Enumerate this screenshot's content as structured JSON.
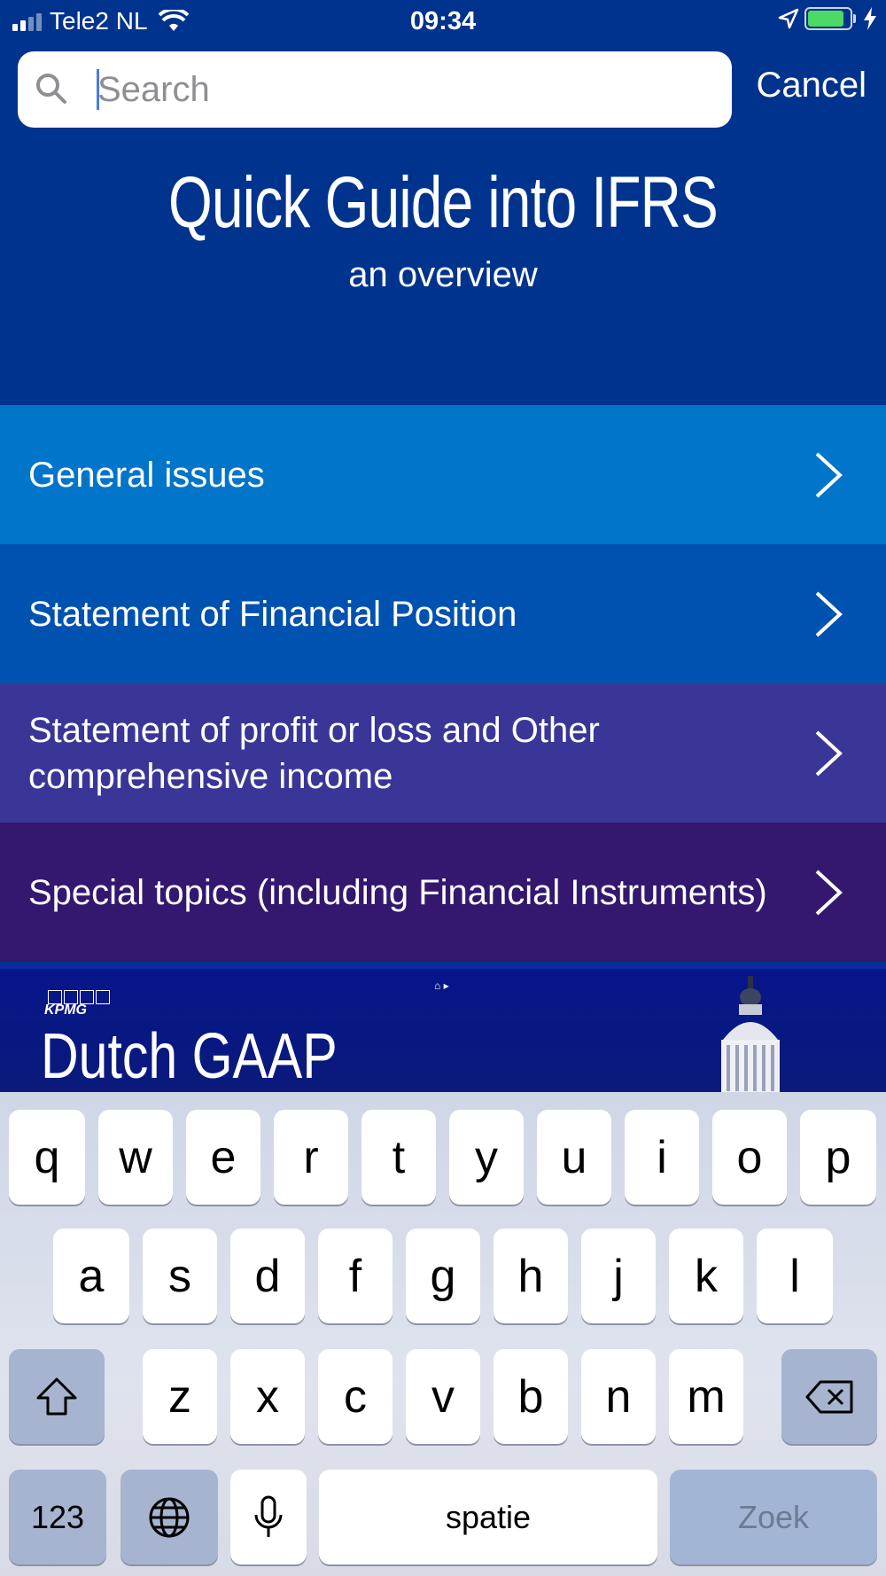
{
  "status_bar": {
    "carrier": "Tele2 NL",
    "time": "09:34"
  },
  "search": {
    "placeholder": "Search",
    "value": "",
    "cancel_label": "Cancel"
  },
  "hero": {
    "title": "Quick Guide into IFRS",
    "subtitle": "an overview"
  },
  "menu": {
    "items": [
      {
        "label": "General issues",
        "color": "#0075C9"
      },
      {
        "label": "Statement of Financial Position",
        "color": "#0052B0"
      },
      {
        "label": "Statement of profit or loss and Other comprehensive income",
        "color": "#3A3698"
      },
      {
        "label": "Special topics (including Financial Instruments)",
        "color": "#34176E"
      }
    ]
  },
  "banner": {
    "brand": "KPMG",
    "title": "Dutch GAAP"
  },
  "keyboard": {
    "row1": [
      "q",
      "w",
      "e",
      "r",
      "t",
      "y",
      "u",
      "i",
      "o",
      "p"
    ],
    "row2": [
      "a",
      "s",
      "d",
      "f",
      "g",
      "h",
      "j",
      "k",
      "l"
    ],
    "row3": [
      "z",
      "x",
      "c",
      "v",
      "b",
      "n",
      "m"
    ],
    "numbers_label": "123",
    "space_label": "spatie",
    "go_label": "Zoek"
  }
}
